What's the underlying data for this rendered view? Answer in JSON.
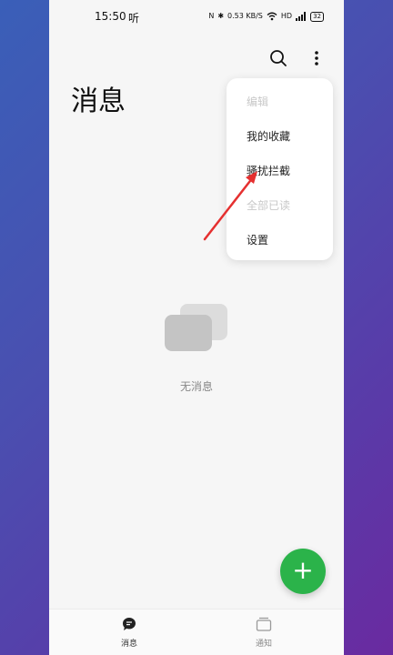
{
  "status_bar": {
    "time": "15:50",
    "extra": "听",
    "icons": [
      "N",
      "✱",
      "0.53 KB/S",
      "wifi",
      "HD",
      "signal"
    ],
    "battery": "32"
  },
  "header": {
    "search_icon": "search-icon",
    "more_icon": "more-vertical-icon"
  },
  "page": {
    "title": "消息"
  },
  "menu": {
    "items": [
      {
        "label": "编辑",
        "enabled": false
      },
      {
        "label": "我的收藏",
        "enabled": true
      },
      {
        "label": "骚扰拦截",
        "enabled": true
      },
      {
        "label": "全部已读",
        "enabled": false
      },
      {
        "label": "设置",
        "enabled": true
      }
    ]
  },
  "empty_state": {
    "text": "无消息"
  },
  "fab": {
    "label": "+"
  },
  "bottom_nav": {
    "items": [
      {
        "label": "消息",
        "active": true
      },
      {
        "label": "通知",
        "active": false
      }
    ]
  },
  "colors": {
    "accent": "#2bb34a",
    "annotation_arrow": "#e53030"
  }
}
